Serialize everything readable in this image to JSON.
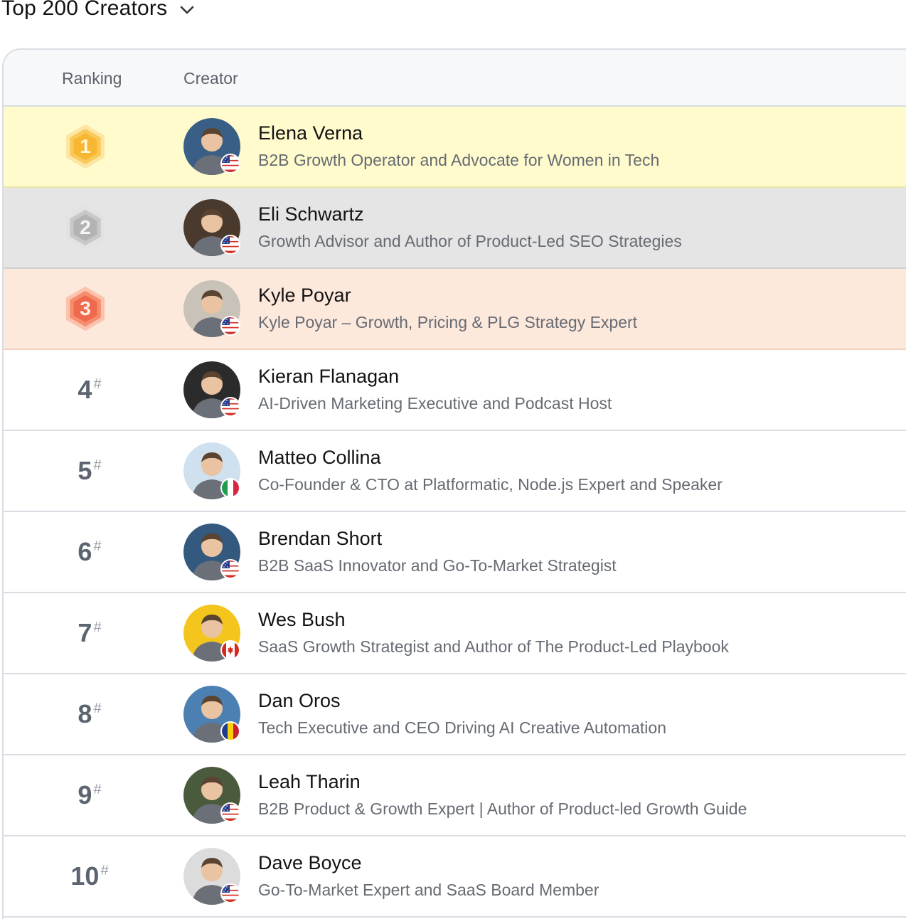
{
  "header": {
    "title": "Top 200 Creators",
    "dropdown_icon": "chevron-down-icon"
  },
  "table": {
    "columns": {
      "ranking": "Ranking",
      "creator": "Creator"
    },
    "rows": [
      {
        "rank": "1",
        "hash": "#",
        "name": "Elena Verna",
        "description": "B2B Growth Operator and Advocate for Women in Tech",
        "flag": "us",
        "badge": "gold",
        "avatar_color": "#3a5f86"
      },
      {
        "rank": "2",
        "hash": "#",
        "name": "Eli Schwartz",
        "description": "Growth Advisor and Author of Product-Led SEO Strategies",
        "flag": "us",
        "badge": "silver",
        "avatar_color": "#4a3a2e"
      },
      {
        "rank": "3",
        "hash": "#",
        "name": "Kyle Poyar",
        "description": "Kyle Poyar – Growth, Pricing & PLG Strategy Expert",
        "flag": "us",
        "badge": "bronze",
        "avatar_color": "#c9c2b8"
      },
      {
        "rank": "4",
        "hash": "#",
        "name": "Kieran Flanagan",
        "description": "AI-Driven Marketing Executive and Podcast Host",
        "flag": "us",
        "badge": "",
        "avatar_color": "#2b2b2b"
      },
      {
        "rank": "5",
        "hash": "#",
        "name": "Matteo Collina",
        "description": "Co-Founder & CTO at Platformatic, Node.js Expert and Speaker",
        "flag": "it",
        "badge": "",
        "avatar_color": "#cfe0ee"
      },
      {
        "rank": "6",
        "hash": "#",
        "name": "Brendan Short",
        "description": "B2B SaaS Innovator and Go-To-Market Strategist",
        "flag": "us",
        "badge": "",
        "avatar_color": "#34597e"
      },
      {
        "rank": "7",
        "hash": "#",
        "name": "Wes Bush",
        "description": "SaaS Growth Strategist and Author of The Product-Led Playbook",
        "flag": "ca",
        "badge": "",
        "avatar_color": "#f4c51c"
      },
      {
        "rank": "8",
        "hash": "#",
        "name": "Dan Oros",
        "description": "Tech Executive and CEO Driving AI Creative Automation",
        "flag": "ro",
        "badge": "",
        "avatar_color": "#4c7fb2"
      },
      {
        "rank": "9",
        "hash": "#",
        "name": "Leah Tharin",
        "description": "B2B Product & Growth Expert | Author of Product-led Growth Guide",
        "flag": "us",
        "badge": "",
        "avatar_color": "#4a5a3c"
      },
      {
        "rank": "10",
        "hash": "#",
        "name": "Dave Boyce",
        "description": "Go-To-Market Expert and SaaS Board Member",
        "flag": "us",
        "badge": "",
        "avatar_color": "#dcdcdc"
      }
    ]
  }
}
